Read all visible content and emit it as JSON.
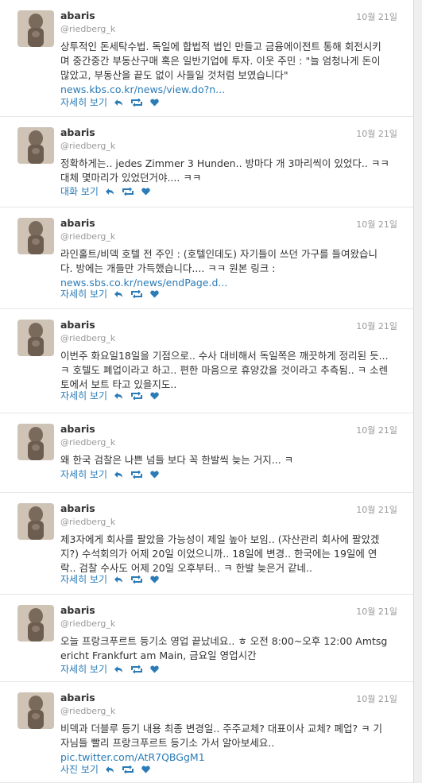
{
  "colors": {
    "link": "#2a7bb6",
    "meta": "#999999",
    "text": "#333333"
  },
  "tweets": [
    {
      "name": "abaris",
      "handle": "@riedberg_k",
      "time": "10월 21일",
      "text": "상투적인 돈세탁수법. 독일에 합법적 법인 만들고 금융에이전트 통해 회전시키며 중간중간 부동산구매 혹은 일반기업에 투자. 이웃 주민 : \"늘 엄청나게 돈이 많았고, 부동산을 끝도 없이 사들일 것처럼 보였습니다\"",
      "link": "news.kbs.co.kr/news/view.do?n...",
      "action": "자세히 보기"
    },
    {
      "name": "abaris",
      "handle": "@riedberg_k",
      "time": "10월 21일",
      "text": "정확하게는.. jedes Zimmer 3 Hunden.. 방마다 개 3마리씩이 있었다.. ㅋㅋ 대체 몇마리가 있었던거야.... ㅋㅋ",
      "link": "",
      "action": "대화 보기"
    },
    {
      "name": "abaris",
      "handle": "@riedberg_k",
      "time": "10월 21일",
      "text": "라인홀트/비덱 호텔 전 주인 : (호텔인데도) 자기들이 쓰던 가구를 들여왔습니다. 방에는 개들만 가득했습니다.... ㅋㅋ 원본 링크 :",
      "link": "news.sbs.co.kr/news/endPage.d...",
      "action": "자세히 보기"
    },
    {
      "name": "abaris",
      "handle": "@riedberg_k",
      "time": "10월 21일",
      "text": "이번주 화요일18일을 기점으로.. 수사 대비해서 독일쪽은 깨끗하게 정리된 듯... ㅋ 호텔도 폐업이라고 하고.. 편한 마음으로 휴양갔을 것이라고 추측됨.. ㅋ 소렌토에서 보트 타고 있을지도..",
      "link": "",
      "action": "자세히 보기"
    },
    {
      "name": "abaris",
      "handle": "@riedberg_k",
      "time": "10월 21일",
      "text": "왜 한국 검찰은 나쁜 넘들 보다 꼭 한발씩 늦는 거지... ㅋ",
      "link": "",
      "action": "자세히 보기"
    },
    {
      "name": "abaris",
      "handle": "@riedberg_k",
      "time": "10월 21일",
      "text": "제3자에게 회사를 팔았을 가능성이 제일 높아 보임.. (자산관리 회사에 팔았겠지?) 수석회의가 어제 20일 이었으니까.. 18일에 변경.. 한국에는 19일에 연락.. 검찰 수사도 어제 20일 오후부터.. ㅋ 한발 늦은거 같네..",
      "link": "",
      "action": "자세히 보기"
    },
    {
      "name": "abaris",
      "handle": "@riedberg_k",
      "time": "10월 21일",
      "text": "오늘 프랑크푸르트 등기소 영업 끝났네요.. ㅎ 오전 8:00~오후 12:00 Amtsgericht Frankfurt am Main, 금요일 영업시간",
      "link": "",
      "action": "자세히 보기"
    },
    {
      "name": "abaris",
      "handle": "@riedberg_k",
      "time": "10월 21일",
      "text": "비덱과 더블루 등기 내용 최종 변경일.. 주주교체? 대표이사 교체? 폐업? ㅋ 기자님들 빨리 프랑크푸르트 등기소 가서 알아보세요..",
      "link": "pic.twitter.com/AtR7QBGgM1",
      "action": "사진 보기"
    }
  ]
}
